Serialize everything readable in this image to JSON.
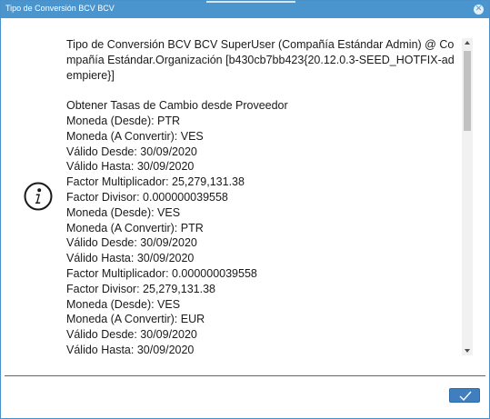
{
  "window": {
    "title": "Tipo de Conversión BCV BCV",
    "close_icon": "close-icon"
  },
  "dialog": {
    "icon": "info-icon",
    "header_line_1": "Tipo de Conversión BCV BCV SuperUser (Compañía Estándar Admin) @ Compañía Estándar.Organización [b430cb7bb423{20.12.0.3-SEED_HOTFIX-adempiere}]",
    "lines": [
      "Obtener Tasas de Cambio desde Proveedor",
      "Moneda (Desde): PTR",
      "Moneda (A Convertir): VES",
      "Válido Desde: 30/09/2020",
      "Válido Hasta: 30/09/2020",
      "Factor Multiplicador: 25,279,131.38",
      "Factor Divisor: 0.000000039558",
      "Moneda (Desde): VES",
      "Moneda (A Convertir): PTR",
      "Válido Desde: 30/09/2020",
      "Válido Hasta: 30/09/2020",
      "Factor Multiplicador: 0.000000039558",
      "Factor Divisor: 25,279,131.38",
      "Moneda (Desde): VES",
      "Moneda (A Convertir): EUR",
      "Válido Desde: 30/09/2020",
      "Válido Hasta: 30/09/2020"
    ]
  },
  "footer": {
    "ok_icon": "checkmark-icon"
  },
  "colors": {
    "titlebar": "#4b95cf",
    "ok_button": "#3f7fbf"
  }
}
